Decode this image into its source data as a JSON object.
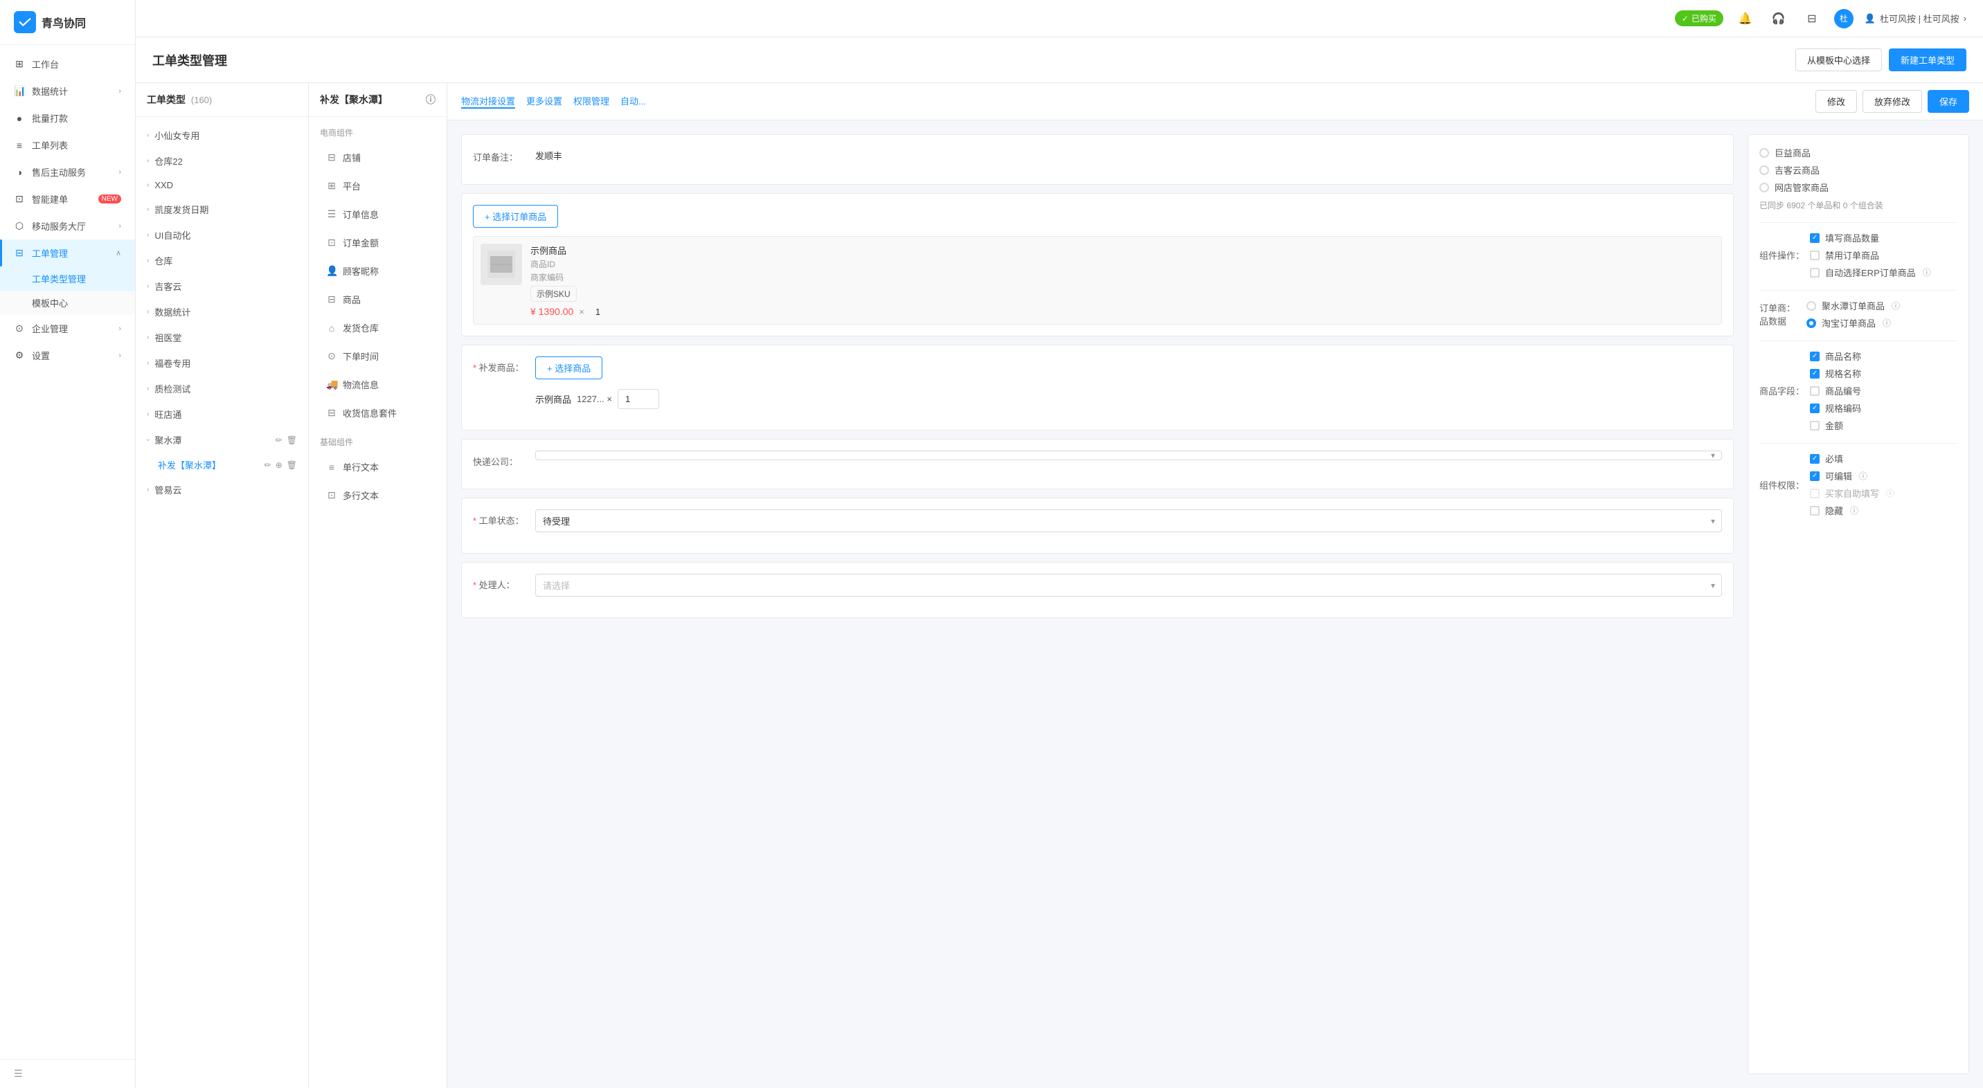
{
  "app": {
    "name": "青鸟协同",
    "logo_char": "✓"
  },
  "header": {
    "purchased_label": "已购买",
    "user_name": "杜可风按 | 杜可风按",
    "user_avatar": "杜"
  },
  "sidebar": {
    "items": [
      {
        "id": "workbench",
        "label": "工作台",
        "icon": "⊞",
        "has_arrow": false
      },
      {
        "id": "data-stats",
        "label": "数据统计",
        "icon": "📊",
        "has_arrow": true
      },
      {
        "id": "batch-payment",
        "label": "批量打款",
        "icon": "●",
        "has_arrow": false
      },
      {
        "id": "work-list",
        "label": "工单列表",
        "icon": "≡",
        "has_arrow": false
      },
      {
        "id": "after-sales",
        "label": "售后主动服务",
        "icon": "◑",
        "has_arrow": true
      },
      {
        "id": "smart-build",
        "label": "智能建单",
        "icon": "⊡",
        "badge": "NEW",
        "has_arrow": false
      },
      {
        "id": "mobile-service",
        "label": "移动服务大厅",
        "icon": "⬡",
        "has_arrow": true
      },
      {
        "id": "work-mgmt",
        "label": "工单管理",
        "icon": "⊟",
        "has_arrow": true,
        "active": true,
        "expanded": true
      },
      {
        "id": "enterprise",
        "label": "企业管理",
        "icon": "⊙",
        "has_arrow": true
      },
      {
        "id": "settings",
        "label": "设置",
        "icon": "⚙",
        "has_arrow": true
      }
    ],
    "sub_items_work_mgmt": [
      {
        "id": "work-type-mgmt",
        "label": "工单类型管理",
        "active": true
      },
      {
        "id": "template-center",
        "label": "模板中心",
        "active": false
      }
    ]
  },
  "page": {
    "title": "工单类型管理",
    "btn_from_template": "从模板中心选择",
    "btn_new": "新建工单类型"
  },
  "type_list": {
    "header": "工单类型",
    "count": "(160)",
    "items": [
      {
        "id": 1,
        "name": "小仙女专用",
        "expanded": false
      },
      {
        "id": 2,
        "name": "仓库22",
        "expanded": false
      },
      {
        "id": 3,
        "name": "XXD",
        "expanded": false
      },
      {
        "id": 4,
        "name": "凯度发货日期",
        "expanded": false
      },
      {
        "id": 5,
        "name": "UI自动化",
        "expanded": false
      },
      {
        "id": 6,
        "name": "仓库",
        "expanded": false
      },
      {
        "id": 7,
        "name": "吉客云",
        "expanded": false
      },
      {
        "id": 8,
        "name": "数据统计",
        "expanded": false
      },
      {
        "id": 9,
        "name": "祖医堂",
        "expanded": false
      },
      {
        "id": 10,
        "name": "福卷专用",
        "expanded": false
      },
      {
        "id": 11,
        "name": "质检测试",
        "expanded": false
      },
      {
        "id": 12,
        "name": "旺店通",
        "expanded": false
      },
      {
        "id": 13,
        "name": "聚水潭",
        "expanded": true
      },
      {
        "id": 14,
        "name": "管易云",
        "expanded": false
      }
    ],
    "sub_items": [
      {
        "name": "补发【聚水潭】",
        "active": true
      }
    ]
  },
  "component_panel": {
    "header": "补发【聚水潭】",
    "info_icon": "ⓘ",
    "ecommerce_section": "电商组件",
    "ecommerce_items": [
      {
        "id": "store",
        "icon": "⊟",
        "label": "店铺"
      },
      {
        "id": "platform",
        "icon": "⊞",
        "label": "平台"
      },
      {
        "id": "order-info",
        "icon": "☰",
        "label": "订单信息"
      },
      {
        "id": "order-amount",
        "icon": "⊡",
        "label": "订单金额"
      },
      {
        "id": "customer-nickname",
        "icon": "👤",
        "label": "顾客昵称"
      },
      {
        "id": "product",
        "icon": "⊟",
        "label": "商品"
      },
      {
        "id": "delivery-warehouse",
        "icon": "⌂",
        "label": "发货仓库"
      },
      {
        "id": "order-time",
        "icon": "⊙",
        "label": "下单时间"
      },
      {
        "id": "logistics-info",
        "icon": "🚚",
        "label": "物流信息"
      },
      {
        "id": "delivery-info",
        "icon": "⊟",
        "label": "收货信息套件"
      }
    ],
    "basic_section": "基础组件",
    "basic_items": [
      {
        "id": "single-text",
        "icon": "≡",
        "label": "单行文本"
      },
      {
        "id": "multi-text",
        "icon": "⊡",
        "label": "多行文本"
      }
    ]
  },
  "toolbar": {
    "links": [
      {
        "id": "logistics-settings",
        "label": "物流对接设置",
        "active": true
      },
      {
        "id": "more-settings",
        "label": "更多设置",
        "active": false
      },
      {
        "id": "permission-mgmt",
        "label": "权限管理",
        "active": false
      },
      {
        "id": "auto",
        "label": "自动...",
        "active": false
      }
    ],
    "btn_edit": "修改",
    "btn_discard": "放弃修改",
    "btn_save": "保存"
  },
  "form": {
    "order_note_label": "订单备注：",
    "order_note_value": "发顺丰",
    "add_product_btn": "+ 选择订单商品",
    "example_product": {
      "name": "示例商品",
      "id_label": "商品ID",
      "merchant_code_label": "商家编码",
      "sku_label": "示例SKU",
      "price": "¥ 1390.00",
      "qty": "1"
    },
    "replenish_product_label": "* 补发商品：",
    "choose_product_btn": "+ 选择商品",
    "example_product2_name": "示例商品",
    "example_product2_sku": "1227... ×",
    "example_product2_qty": "1",
    "express_company_label": "快递公司：",
    "work_status_label": "* 工单状态：",
    "work_status_value": "待受理",
    "handler_label": "* 处理人：",
    "handler_placeholder": "请选择"
  },
  "settings": {
    "product_type_label": "已同步",
    "synced_info": "已同步 6902 个单品和 0 个组合装",
    "product_options": [
      {
        "id": "beneficial",
        "label": "巨益商品",
        "selected": false
      },
      {
        "id": "jike-cloud",
        "label": "吉客云商品",
        "selected": false
      },
      {
        "id": "online-store",
        "label": "网店管家商品",
        "selected": false
      }
    ],
    "operation_label": "组件操作：",
    "operation_items": [
      {
        "id": "fill-qty",
        "label": "填写商品数量",
        "checked": true
      },
      {
        "id": "disable-order",
        "label": "禁用订单商品",
        "checked": false
      },
      {
        "id": "auto-erp",
        "label": "自动选择ERP订单商品",
        "checked": false,
        "has_info": true
      }
    ],
    "order_data_label": "订单商品数据",
    "order_data_options": [
      {
        "id": "jushuitan",
        "label": "聚水潭订单商品",
        "selected": false,
        "has_info": true
      },
      {
        "id": "taobao",
        "label": "淘宝订单商品",
        "selected": true,
        "has_info": true
      }
    ],
    "product_fields_label": "商品字段：",
    "product_fields": [
      {
        "id": "product-name",
        "label": "商品名称",
        "checked": true
      },
      {
        "id": "spec-name",
        "label": "规格名称",
        "checked": true
      },
      {
        "id": "product-code",
        "label": "商品编号",
        "checked": false
      },
      {
        "id": "spec-code",
        "label": "规格编码",
        "checked": true
      },
      {
        "id": "amount",
        "label": "金额",
        "checked": false
      }
    ],
    "permission_label": "组件权限：",
    "permission_items": [
      {
        "id": "required",
        "label": "必填",
        "checked": true
      },
      {
        "id": "editable",
        "label": "可编辑",
        "checked": true,
        "has_info": true
      },
      {
        "id": "buyer-fill",
        "label": "买家自助填写",
        "checked": false,
        "has_info": true,
        "disabled": true
      },
      {
        "id": "hidden",
        "label": "隐藏",
        "checked": false,
        "has_info": true
      }
    ]
  }
}
